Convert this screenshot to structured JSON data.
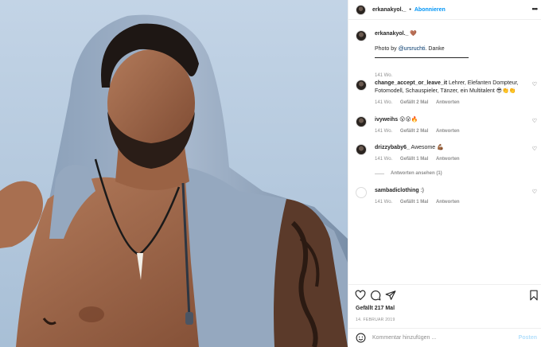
{
  "header": {
    "username": "erkanakyol._",
    "separator": "•",
    "follow_label": "Abonnieren",
    "more_label": "•••"
  },
  "caption": {
    "username": "erkanakyol._",
    "emoji": "🤎",
    "text_prefix": "Photo by ",
    "mention": "@ursruchti",
    "text_suffix": ". Danke",
    "time": "141 Wo."
  },
  "comments": [
    {
      "username": "change_accept_or_leave_it",
      "text": "Lehrer, Elefanten Dompteur, Fotomodell, Schauspieler, Tänzer, ein Multitalent 😎👏👏",
      "time": "141 Wo.",
      "likes": "Gefällt 2 Mal",
      "reply": "Antworten"
    },
    {
      "username": "ivyweihs",
      "text": "😮😮🔥",
      "time": "141 Wo.",
      "likes": "Gefällt 2 Mal",
      "reply": "Antworten"
    },
    {
      "username": "drizzybaby6_",
      "text": "Awesome 💪🏾",
      "time": "141 Wo.",
      "likes": "Gefällt 1 Mal",
      "reply": "Antworten",
      "view_replies": "Antworten ansehen (1)"
    },
    {
      "username": "sambadiclothing",
      "text": ":)",
      "time": "141 Wo.",
      "likes": "Gefällt 1 Mal",
      "reply": "Antworten"
    }
  ],
  "actions": {
    "icons": [
      "heart-icon",
      "comment-icon",
      "share-icon",
      "bookmark-icon"
    ],
    "likes_count": "Gefällt 217 Mal",
    "date": "14. FEBRUAR 2019"
  },
  "add_comment": {
    "placeholder": "Kommentar hinzufügen ...",
    "post_label": "Posten",
    "emoji_icon": "smiley-icon"
  },
  "colors": {
    "accent": "#0095f6",
    "post_disabled": "#b2dffc",
    "muted": "#8e8e8e",
    "border": "#efefef"
  }
}
